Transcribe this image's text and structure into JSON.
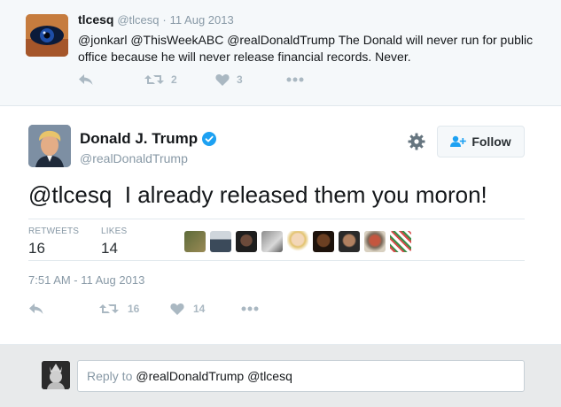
{
  "parent_tweet": {
    "name": "tlcesq",
    "handle": "@tlcesq",
    "separator": "·",
    "date": "11 Aug 2013",
    "text": "@jonkarl @ThisWeekABC @realDonaldTrump The Donald will never run for public office because he will never release financial records. Never.",
    "actions": {
      "reply_icon": "reply-icon",
      "retweet_icon": "retweet-icon",
      "retweet_count": "2",
      "like_icon": "heart-icon",
      "like_count": "3",
      "more_icon": "more-dots-icon"
    }
  },
  "main_tweet": {
    "name": "Donald J. Trump",
    "handle": "@realDonaldTrump",
    "verified_icon": "verified-badge-icon",
    "follow_label": "Follow",
    "text": "@tlcesq  I already released them you moron!",
    "stats": {
      "retweets_label": "RETWEETS",
      "retweets_value": "16",
      "likes_label": "LIKES",
      "likes_value": "14"
    },
    "timestamp": "7:51 AM - 11 Aug 2013",
    "actions": {
      "retweet_count": "16",
      "like_count": "14"
    }
  },
  "reply": {
    "prefix": "Reply to",
    "mentions": "@realDonaldTrump @tlcesq"
  },
  "colors": {
    "accent": "#1da1f2",
    "muted": "#8899a6",
    "action_grey": "#aab8c2",
    "parent_bg": "#f5f8fa",
    "reply_bg": "#e8eaeb"
  }
}
